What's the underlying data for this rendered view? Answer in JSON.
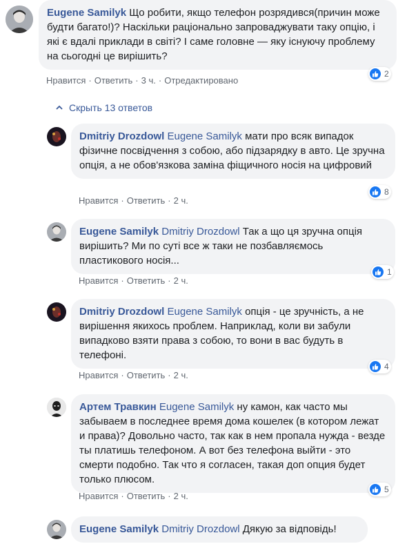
{
  "main_comment": {
    "author": "Eugene Samilyk",
    "text": "Що робити, якщо телефон розрядився(причин може будти багато!)? Наскільки раціонально запроваджувати таку опцію, і які є вдалі приклади в світі? І саме головне — яку існуючу проблему на сьогодні це вирішить?",
    "like_label": "Нравится",
    "reply_label": "Ответить",
    "time": "3 ч.",
    "edited_label": "Отредактировано",
    "reaction_count": "2"
  },
  "hide_replies_label": "Скрыть 13 ответов",
  "replies": [
    {
      "author": "Dmitriy Drozdowl",
      "mention": "Eugene Samilyk",
      "text": "мати про всяк випадок фізичне посвідчення з собою, або підзарядку в авто. Це зручна опція, а не обов'язкова заміна фіщичного носія на цифровий",
      "like_label": "Нравится",
      "reply_label": "Ответить",
      "time": "2 ч.",
      "reaction_count": "8"
    },
    {
      "author": "Eugene Samilyk",
      "mention": "Dmitriy Drozdowl",
      "text": "Так а що ця зручна опція вирішить? Ми по суті все ж таки не позбавляємось пластикового носія...",
      "like_label": "Нравится",
      "reply_label": "Ответить",
      "time": "2 ч.",
      "reaction_count": "1"
    },
    {
      "author": "Dmitriy Drozdowl",
      "mention": "Eugene Samilyk",
      "text": "опція - це зручність, а не вирішення якихось проблем. Наприклад, коли ви забули випадково взяти права з собою, то вони в вас будуть в телефоні.",
      "like_label": "Нравится",
      "reply_label": "Ответить",
      "time": "2 ч.",
      "reaction_count": "4"
    },
    {
      "author": "Артем Травкин",
      "mention": "Eugene Samilyk",
      "text": "ну камон, как часто мы забываем в последнее время дома кошелек (в котором лежат и права)? Довольно часто, так как в нем пропала нужда - везде ты платишь телефоном. А вот без телефона выйти - это смерти подобно. Так что я согласен, такая доп опция будет только плюсом.",
      "like_label": "Нравится",
      "reply_label": "Ответить",
      "time": "2 ч.",
      "reaction_count": "5"
    },
    {
      "author": "Eugene Samilyk",
      "mention": "Dmitriy Drozdowl",
      "text": "Дякую за відповідь!"
    }
  ]
}
